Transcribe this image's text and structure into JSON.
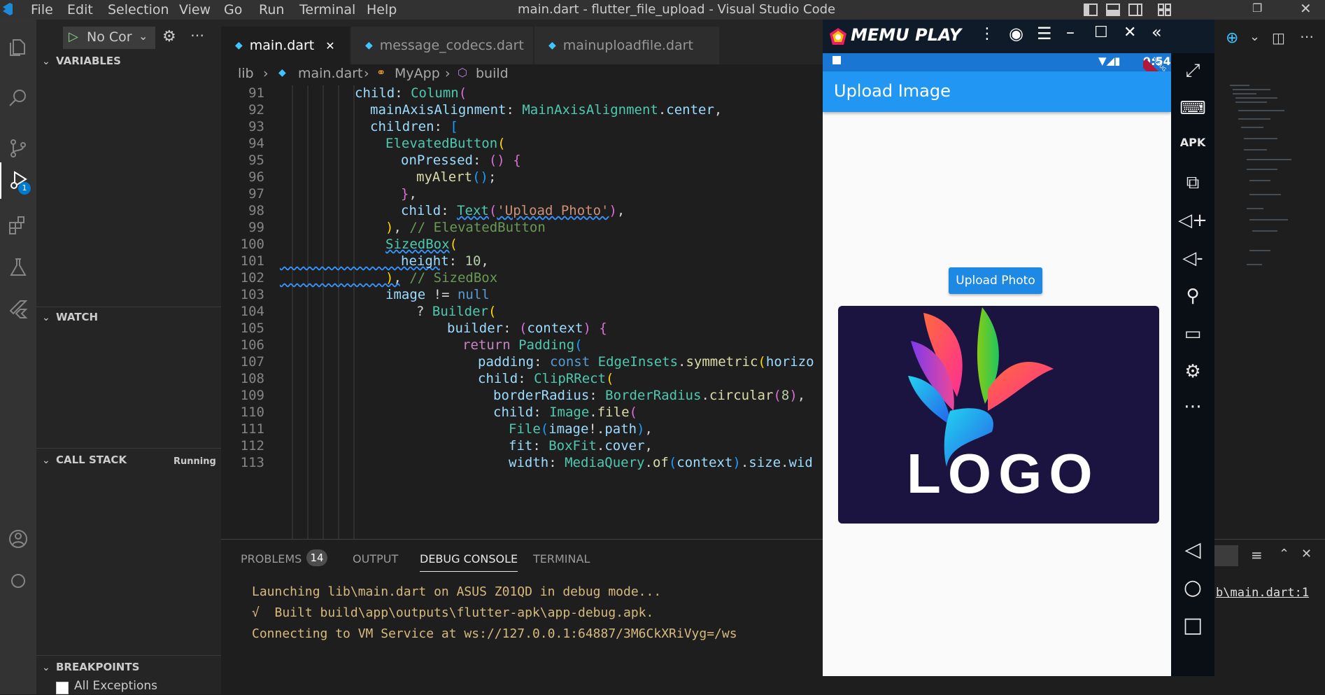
{
  "titlebar": {
    "menus": [
      "File",
      "Edit",
      "Selection",
      "View",
      "Go",
      "Run",
      "Terminal",
      "Help"
    ],
    "title": "main.dart - flutter_file_upload - Visual Studio Code"
  },
  "activity": {
    "icons": [
      "explorer-icon",
      "search-icon",
      "source-control-icon",
      "run-debug-icon",
      "extensions-icon",
      "testing-icon",
      "flutter-icon",
      "account-icon"
    ],
    "debug_badge": "1"
  },
  "debug_toolbar": {
    "config_label": "No Cor"
  },
  "sidebar": {
    "variables": "VARIABLES",
    "watch": "WATCH",
    "call_stack": "CALL STACK",
    "call_stack_status": "Running",
    "breakpoints": "BREAKPOINTS",
    "all_exceptions": "All Exceptions"
  },
  "tabs": [
    {
      "label": "main.dart",
      "active": true
    },
    {
      "label": "message_codecs.dart",
      "active": false
    },
    {
      "label": "mainuploadfile.dart",
      "active": false
    }
  ],
  "breadcrumb": [
    "lib",
    "main.dart",
    "MyApp",
    "build"
  ],
  "code_lines": [
    {
      "n": "91"
    },
    {
      "n": "92"
    },
    {
      "n": "93"
    },
    {
      "n": "94"
    },
    {
      "n": "95"
    },
    {
      "n": "96"
    },
    {
      "n": "97"
    },
    {
      "n": "98"
    },
    {
      "n": "99"
    },
    {
      "n": "100"
    },
    {
      "n": "101"
    },
    {
      "n": "102"
    },
    {
      "n": "103"
    },
    {
      "n": "104"
    },
    {
      "n": "105"
    },
    {
      "n": "106"
    },
    {
      "n": "107"
    },
    {
      "n": "108"
    },
    {
      "n": "109"
    },
    {
      "n": "110"
    },
    {
      "n": "111"
    },
    {
      "n": "112"
    },
    {
      "n": "113"
    }
  ],
  "panel": {
    "tabs": [
      "PROBLEMS",
      "OUTPUT",
      "DEBUG CONSOLE",
      "TERMINAL"
    ],
    "problems_count": "14",
    "active_tab": "DEBUG CONSOLE",
    "console": [
      "Launching lib\\main.dart on ASUS Z01QD in debug mode...",
      "√  Built build\\app\\outputs\\flutter-apk\\app-debug.apk.",
      "Connecting to VM Service at ws://127.0.0.1:64887/3M6CkXRiVyg=/ws"
    ],
    "right_link": "b\\main.dart:1"
  },
  "emulator": {
    "brand": "MEMU PLAY",
    "time": "9:54",
    "debug_ribbon": "DEBUG",
    "app_title": "Upload Image",
    "button_label": "Upload Photo",
    "image_text": "LOGO",
    "colors": {
      "appbar": "#2196f3",
      "status": "#1976d2",
      "button": "#1e88e5",
      "image_bg": "#1b1340"
    }
  }
}
